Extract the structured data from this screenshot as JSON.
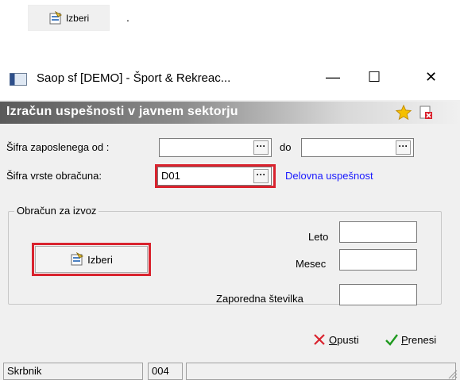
{
  "top_button": {
    "label": "Izberi",
    "icon": "select-form-icon"
  },
  "top_dot": ".",
  "window": {
    "title": "Saop sf [DEMO] - Šport & Rekreac...",
    "controls": {
      "minimize": "—",
      "maximize": "☐",
      "close": "✕"
    }
  },
  "header": {
    "title": "Izračun uspešnosti v javnem sektorju"
  },
  "form": {
    "emp_from_label": "Šifra zaposlenega od :",
    "emp_from_value": "",
    "emp_to_label": "do",
    "emp_to_value": "",
    "calc_type_label": "Šifra vrste obračuna:",
    "calc_type_value": "D01",
    "calc_type_desc": "Delovna uspešnost",
    "ellipsis": "···"
  },
  "group": {
    "legend": "Obračun za izvoz",
    "izberi_label": "Izberi",
    "leto_label": "Leto",
    "leto_value": "",
    "mesec_label": "Mesec",
    "mesec_value": "",
    "zap_label": "Zaporedna številka",
    "zap_value": ""
  },
  "actions": {
    "cancel_first": "O",
    "cancel_rest": "pusti",
    "transfer_first": "P",
    "transfer_rest": "renesi"
  },
  "status": {
    "user": "Skrbnik",
    "code": "004",
    "extra": ""
  },
  "colors": {
    "highlight": "#d9232e",
    "link": "#1a1aff",
    "header_dark": "#5a5a5a"
  }
}
